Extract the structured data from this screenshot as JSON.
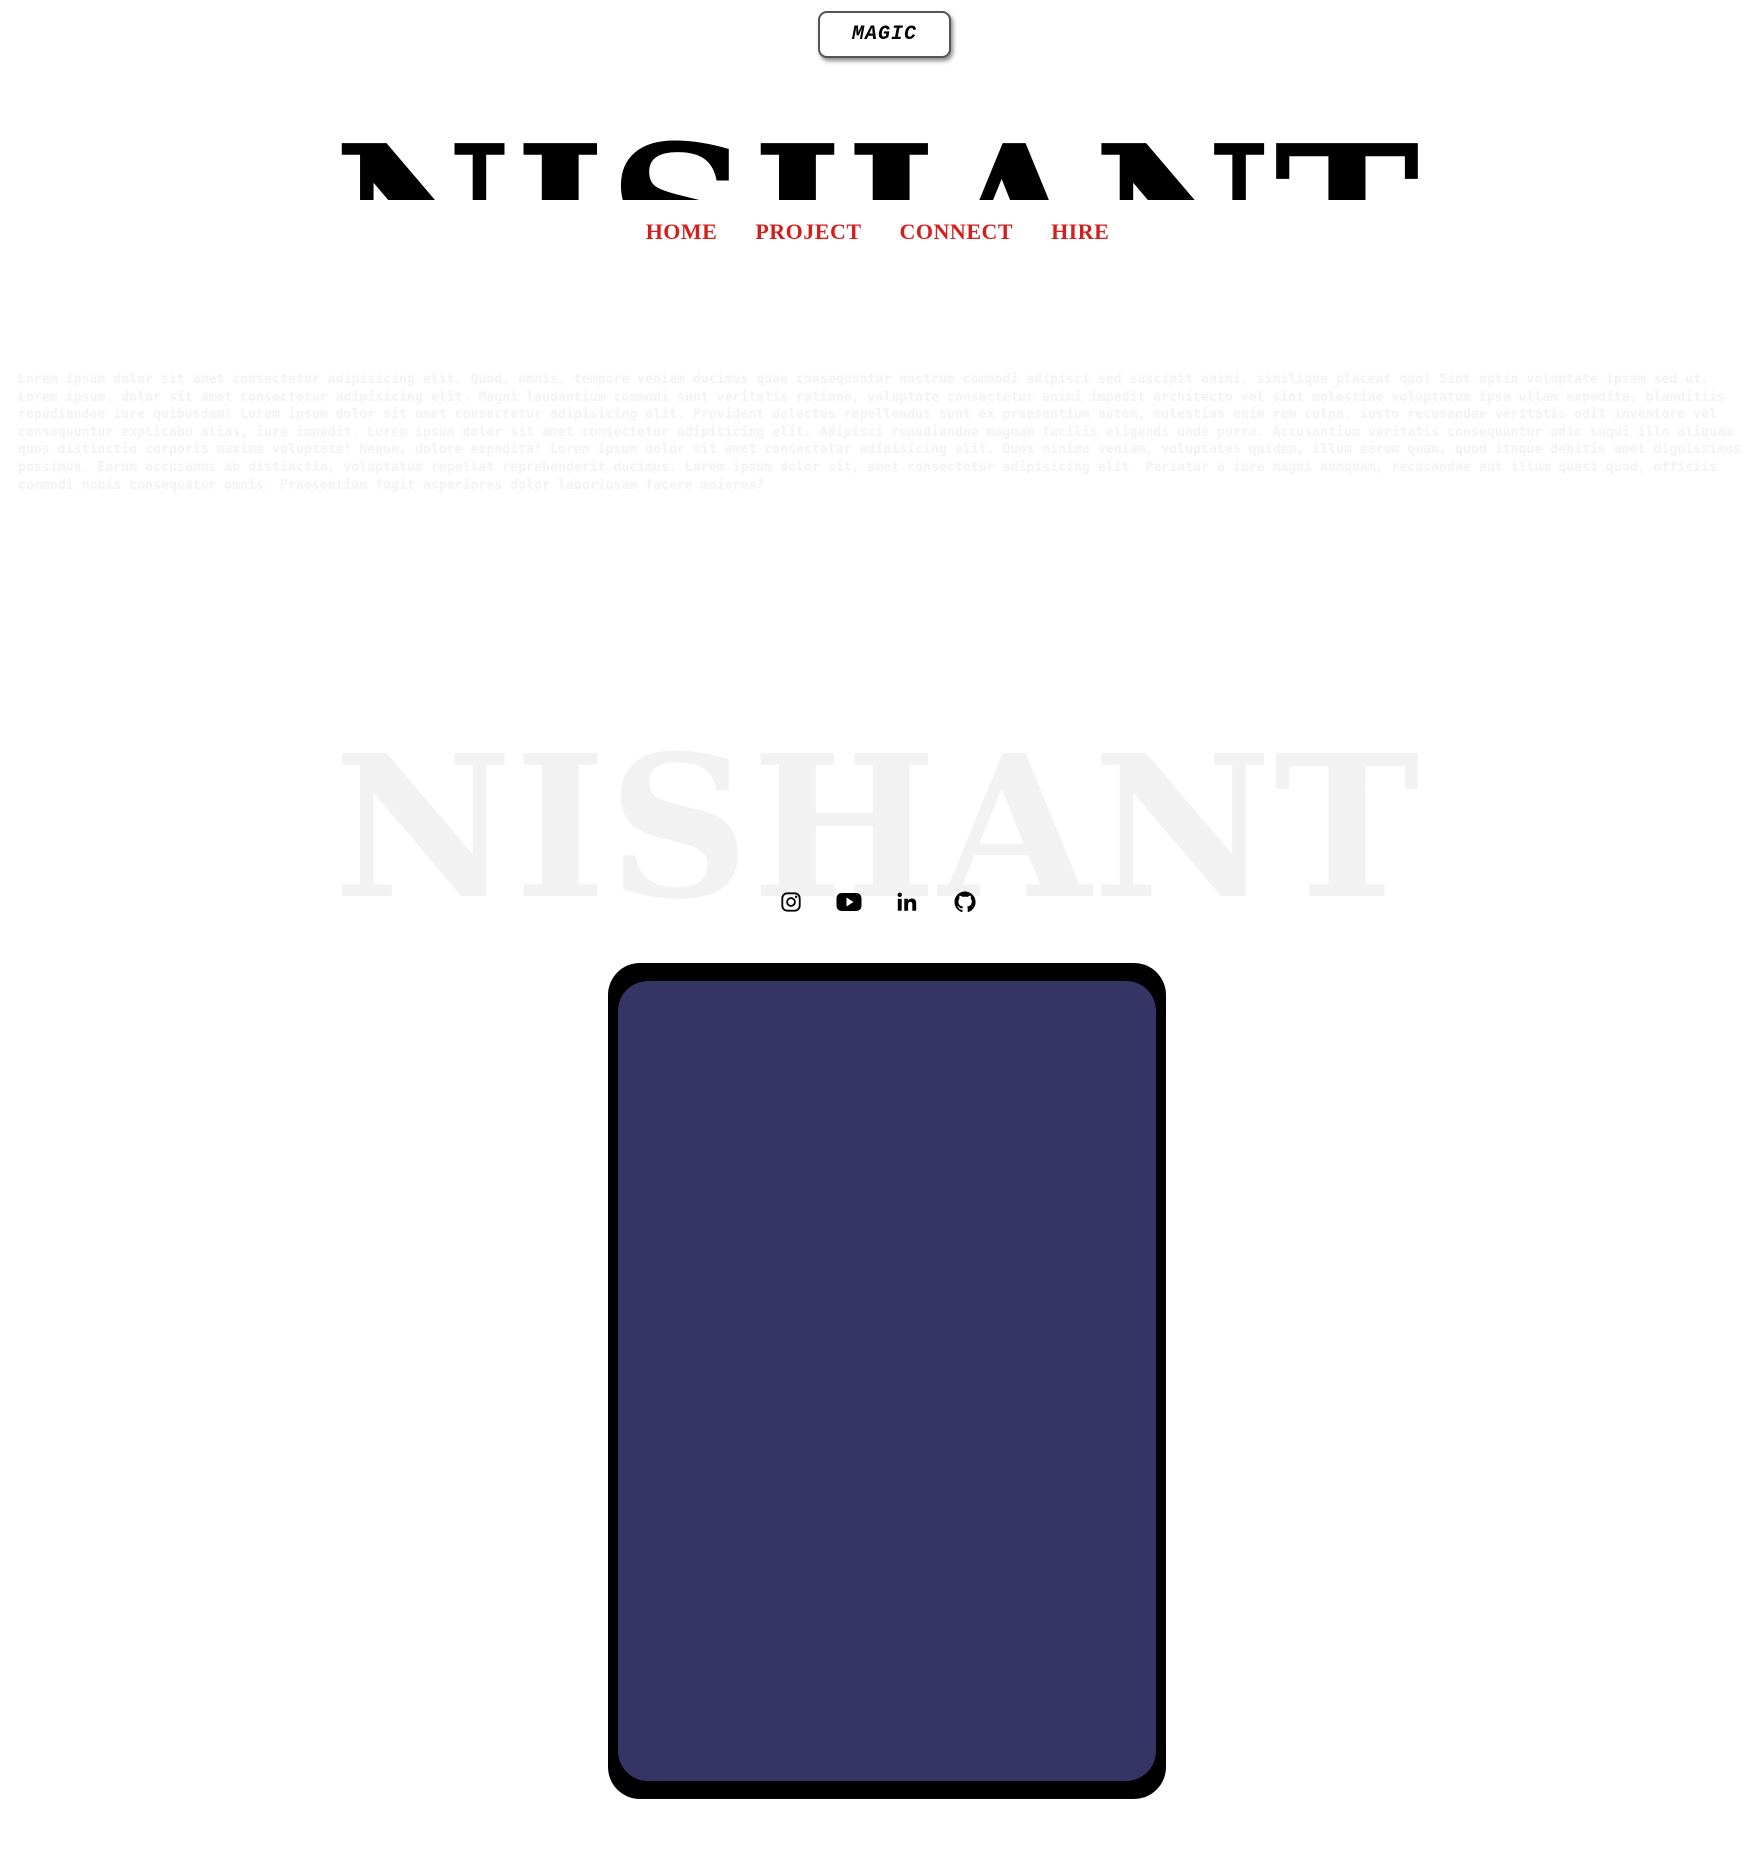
{
  "magic_button": {
    "label": "MAGIC"
  },
  "hero": {
    "title": "NISHANT"
  },
  "nav": {
    "items": [
      {
        "label": "HOME"
      },
      {
        "label": "PROJECT"
      },
      {
        "label": "CONNECT"
      },
      {
        "label": "HIRE"
      }
    ]
  },
  "intro": {
    "text": "Lorem ipsum dolor sit amet consectetur adipisicing elit. Quod, omnis, tempore veniam ducimus quae consequuntur nostrum commodi adipisci sed suscipit animi, similique placeat quo! Sint optio voluptate ipsam sed ut. Lorem ipsum, dolor sit amet consectetur adipisicing elit. Magni laudantium commodi sunt veritatis ratione, voluptate consectetur animi impedit architecto vel sint molestiae voluptatum ipsa ullam expedita, blanditiis repudiandae iure quibusdam! Lorem ipsum dolor sit amet consectetur adipisicing elit. Provident delectus repellendus sunt ex praesentium autem, molestias enim rem culpa, iusto recusandae veritatis odit inventore vel consequuntur explicabo alias, iure impedit. Lorem ipsum dolor sit amet consectetur adipisicing elit. Adipisci repudiandae magnam facilis eligendi unde porro. Accusantium veritatis consequuntur odio sequi illo aliquam quos distinctio corporis maxime voluptate! Neque, dolore expedita! Lorem ipsum dolor sit amet consectetur adipisicing elit. Quos minima veniam, voluptates quidem, illum earum quam, quod itaque debitis amet dignissimos possimus. Earum accusamus ab distinctio, voluptatum repellat reprehenderit ducimus. Lorem ipsum dolor sit, amet consectetur adipisicing elit. Pariatur a iure magni numquam, recusandae aut illum quasi quod, officiis commodi nobis consequatur omnis. Praesentium fugit asperiores dolor laboriosam facere maiores?"
  },
  "background_name": {
    "text": "NISHANT"
  },
  "social": {
    "icons": [
      "instagram-icon",
      "youtube-icon",
      "linkedin-icon",
      "github-icon"
    ]
  },
  "colors": {
    "nav_link": "#d41f1f",
    "device_frame": "#000000",
    "device_screen": "#353565",
    "faded_text": "#f2f2f2"
  }
}
